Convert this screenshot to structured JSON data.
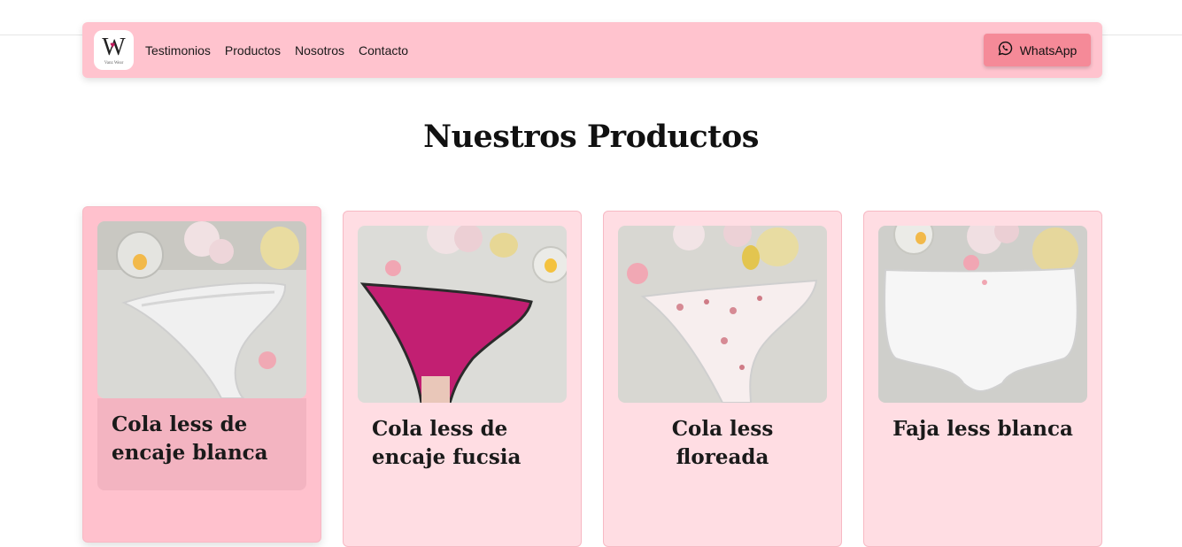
{
  "nav": {
    "logo_letter": "W",
    "logo_text": "Vanz Wear",
    "links": [
      "Testimonios",
      "Productos",
      "Nosotros",
      "Contacto"
    ],
    "whatsapp_label": "WhatsApp"
  },
  "main": {
    "title": "Nuestros Productos",
    "products": [
      {
        "name": "Cola less de encaje blanca"
      },
      {
        "name": "Cola less de encaje fucsia"
      },
      {
        "name": "Cola less floreada"
      },
      {
        "name": "Faja less blanca"
      }
    ]
  },
  "colors": {
    "navbar_bg": "#ffc3ce",
    "whatsapp_bg": "#f58a98",
    "card_bg": "#ffdde3",
    "card_active_bg": "#ffc1cd"
  }
}
